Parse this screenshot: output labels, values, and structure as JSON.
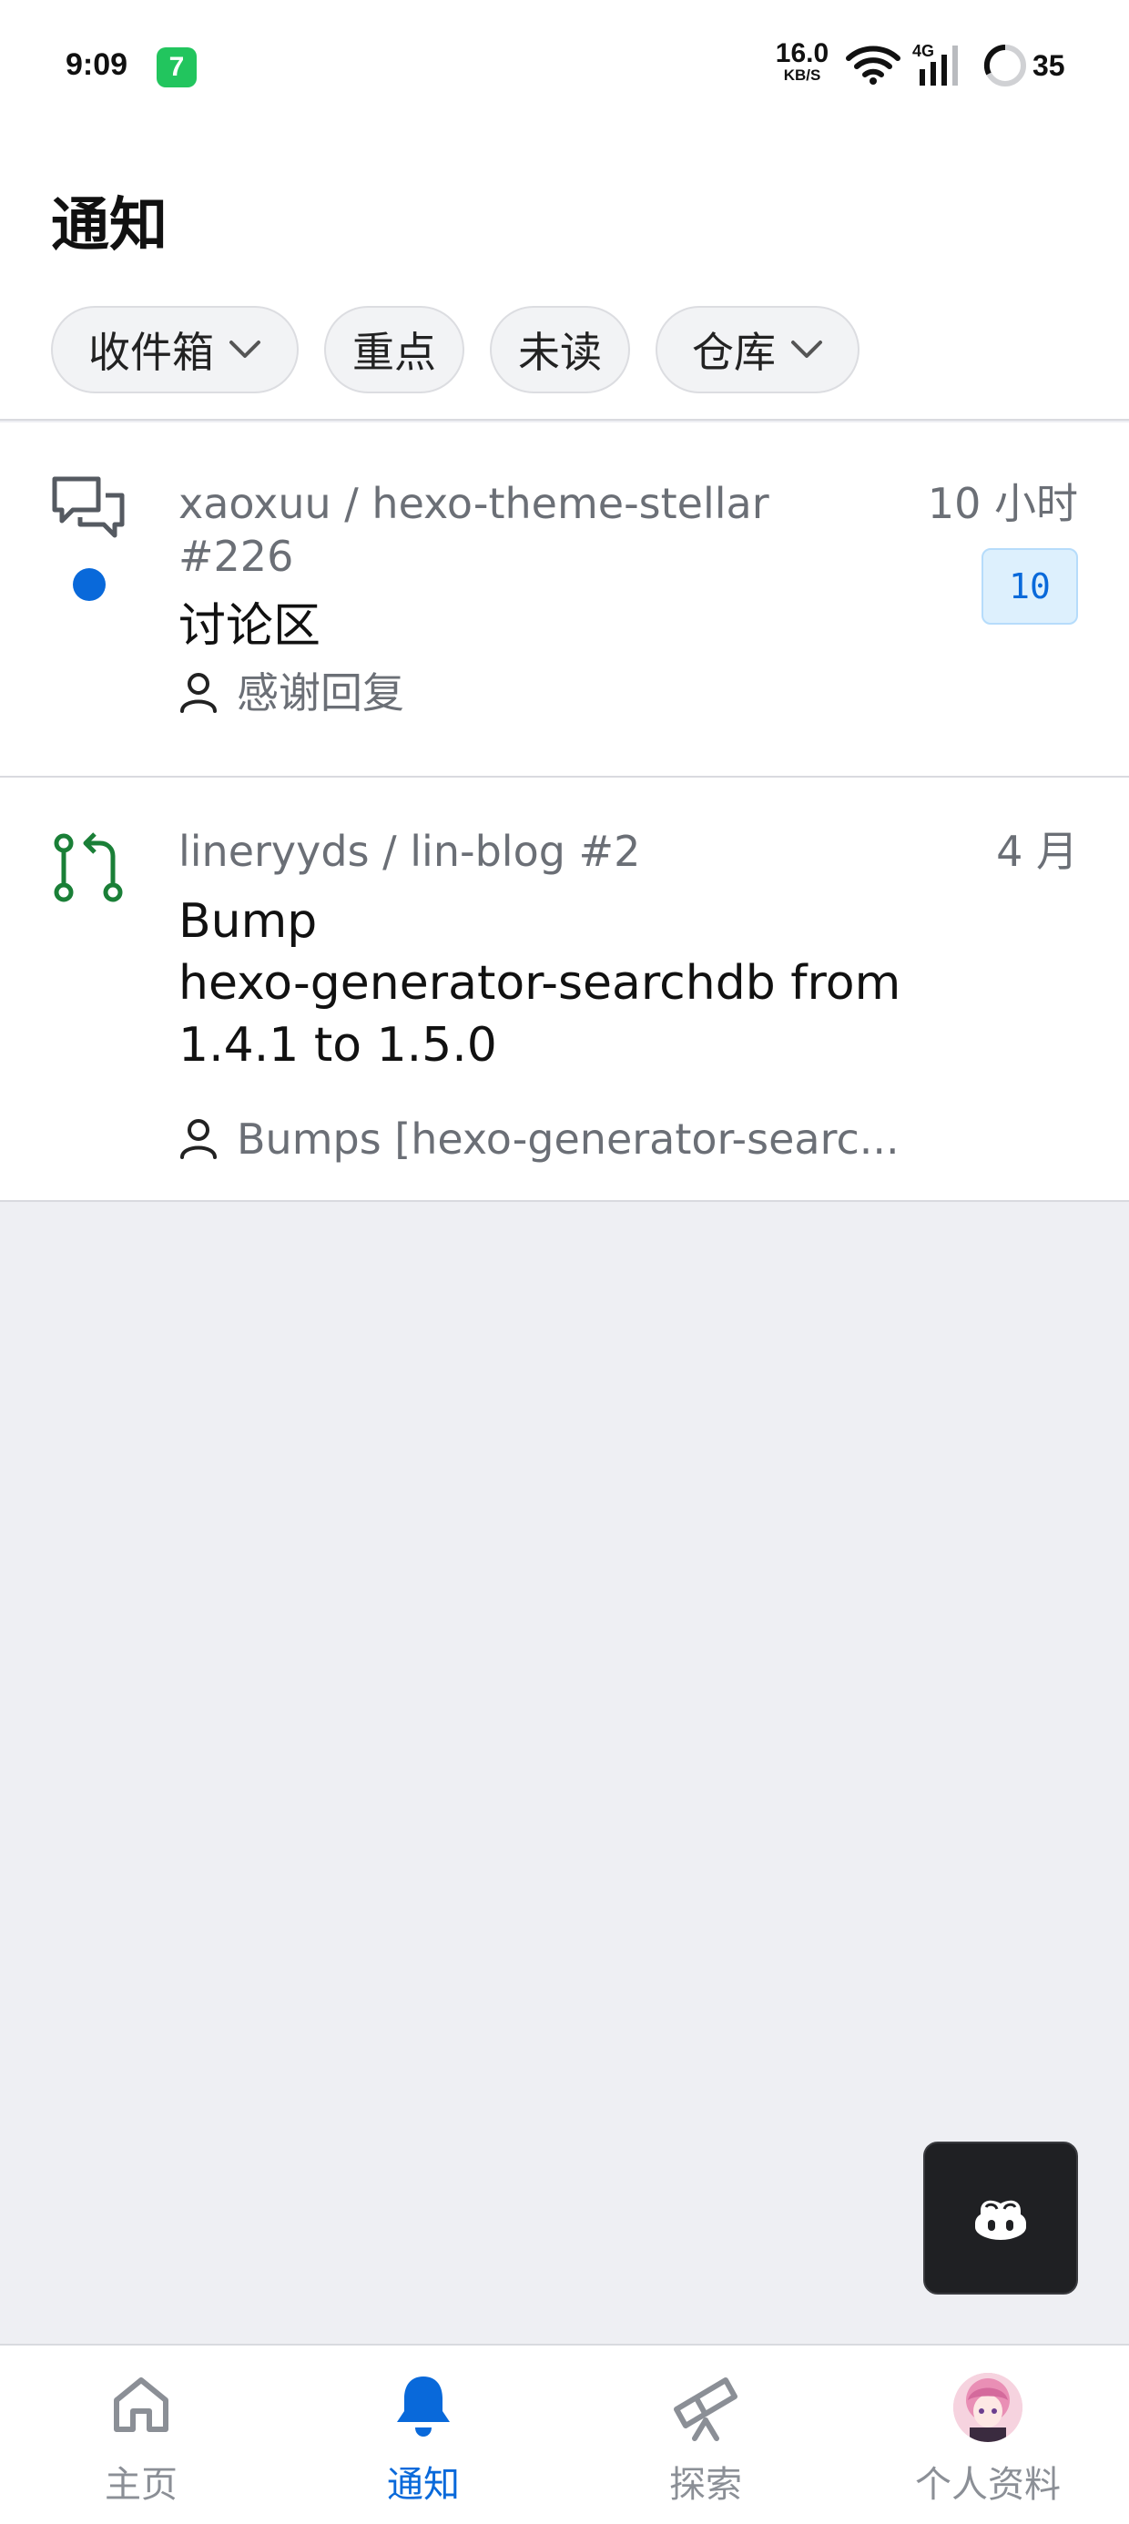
{
  "status_bar": {
    "time": "9:09",
    "app_badge": "7",
    "net_speed": "16.0",
    "net_unit": "KB/S",
    "network_type": "4G",
    "battery": "35"
  },
  "header": {
    "title": "通知",
    "filters": [
      {
        "label": "收件箱",
        "dropdown": true
      },
      {
        "label": "重点",
        "dropdown": false
      },
      {
        "label": "未读",
        "dropdown": false
      },
      {
        "label": "仓库",
        "dropdown": true
      }
    ]
  },
  "notifications": [
    {
      "icon": "discussion-icon",
      "repo_line1": "xaoxuu / hexo-theme-stellar",
      "repo_line2": "#226",
      "time": "10 小时",
      "count": "10",
      "unread": true,
      "title": "讨论区",
      "author_text": "感谢回复"
    },
    {
      "icon": "pull-request-icon",
      "repo_line1": "lineryyds / lin-blog #2",
      "time": "4 月",
      "unread": false,
      "title_lines": [
        "Bump",
        "hexo-generator-searchdb from",
        "1.4.1 to 1.5.0"
      ],
      "author_text": "Bumps [hexo-generator-searc..."
    }
  ],
  "fab": {
    "icon": "copilot-icon"
  },
  "bottom_nav": [
    {
      "label": "主页",
      "icon": "home-icon",
      "active": false
    },
    {
      "label": "通知",
      "icon": "bell-icon",
      "active": true
    },
    {
      "label": "探索",
      "icon": "telescope-icon",
      "active": false
    },
    {
      "label": "个人资料",
      "icon": "avatar",
      "active": false
    }
  ],
  "colors": {
    "accent": "#0969da",
    "pr_green": "#1a7f37",
    "background": "#eeeff3"
  }
}
